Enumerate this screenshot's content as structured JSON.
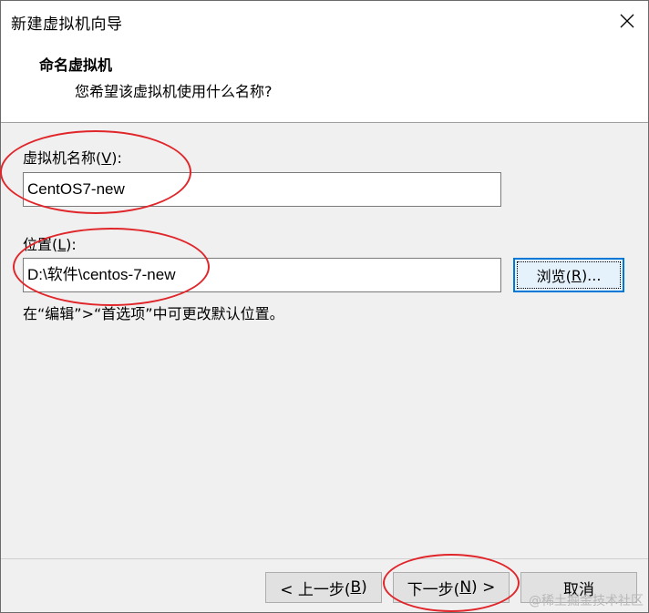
{
  "window": {
    "title": "新建虚拟机向导",
    "close_icon": "close-icon"
  },
  "header": {
    "title": "命名虚拟机",
    "subtitle": "您希望该虚拟机使用什么名称?"
  },
  "form": {
    "name_label_prefix": "虚拟机名称(",
    "name_label_key": "V",
    "name_label_suffix": "):",
    "name_value": "CentOS7-new",
    "location_label_prefix": "位置(",
    "location_label_key": "L",
    "location_label_suffix": "):",
    "location_value": "D:\\软件\\centos-7-new",
    "browse_prefix": "浏览(",
    "browse_key": "R",
    "browse_suffix": ")...",
    "hint": "在“编辑”>“首选项”中可更改默认位置。"
  },
  "footer": {
    "back_prefix": "< 上一步(",
    "back_key": "B",
    "back_suffix": ")",
    "next_prefix": "下一步(",
    "next_key": "N",
    "next_suffix": ") >",
    "cancel": "取消"
  },
  "annotation_color": "#e0262a",
  "watermark": "@稀土掘金技术社区"
}
